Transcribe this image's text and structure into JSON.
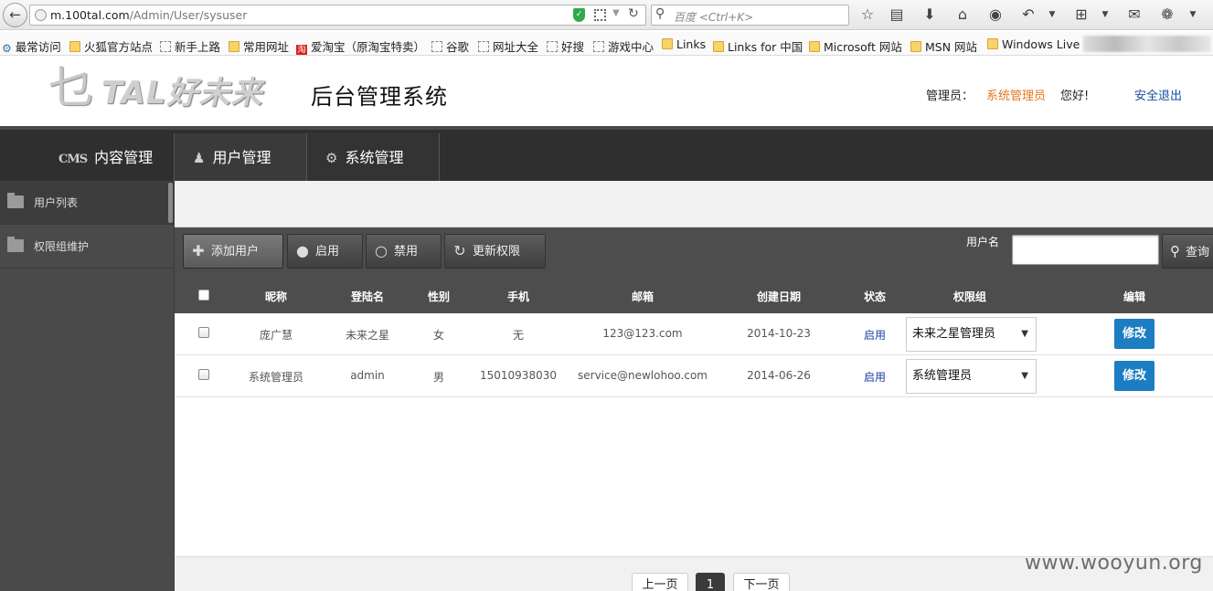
{
  "browser": {
    "url_host": "m.100tal.com",
    "url_path": "/Admin/User/sysuser",
    "search_placeholder": "百度 <Ctrl+K>",
    "bookmarks": [
      "最常访问",
      "火狐官方站点",
      "新手上路",
      "常用网址",
      "爱淘宝（原淘宝特卖）",
      "谷歌",
      "网址大全",
      "好搜",
      "游戏中心",
      "Links",
      "Links for 中国",
      "Microsoft 网站",
      "MSN 网站",
      "Windows Live"
    ]
  },
  "header": {
    "logo_text": "TAL好未来",
    "title": "后台管理系统",
    "admin_label": "管理员：",
    "admin_name": "系统管理员",
    "greeting": "您好!",
    "logout": "安全退出"
  },
  "nav": {
    "tabs": [
      {
        "icon": "CMS",
        "label": "内容管理"
      },
      {
        "icon": "user-icon",
        "label": "用户管理"
      },
      {
        "icon": "gear-icon",
        "label": "系统管理"
      }
    ],
    "active_index": 1
  },
  "sidebar": {
    "items": [
      {
        "label": "用户列表",
        "active": true
      },
      {
        "label": "权限组维护",
        "active": false
      }
    ]
  },
  "actions": {
    "add": "添加用户",
    "enable": "启用",
    "disable": "禁用",
    "refresh": "更新权限",
    "search_label": "用户名",
    "search_button": "查询"
  },
  "table": {
    "headers": [
      "昵称",
      "登陆名",
      "性别",
      "手机",
      "邮箱",
      "创建日期",
      "状态",
      "权限组",
      "编辑"
    ],
    "rows": [
      {
        "nickname": "庞广慧",
        "login": "未来之星",
        "gender": "女",
        "phone": "无",
        "email": "123@123.com",
        "created": "2014-10-23",
        "status": "启用",
        "group": "未来之星管理员",
        "edit": "修改"
      },
      {
        "nickname": "系统管理员",
        "login": "admin",
        "gender": "男",
        "phone": "15010938030",
        "email": "service@newlohoo.com",
        "created": "2014-06-26",
        "status": "启用",
        "group": "系统管理员",
        "edit": "修改"
      }
    ]
  },
  "pager": {
    "prev": "上一页",
    "current": "1",
    "next": "下一页"
  },
  "watermark": "www.wooyun.org",
  "colors": {
    "accent": "#e8761c",
    "link": "#1a4f9c",
    "edit_button": "#1d7dc2",
    "dark_bar": "#4d4d4d"
  }
}
